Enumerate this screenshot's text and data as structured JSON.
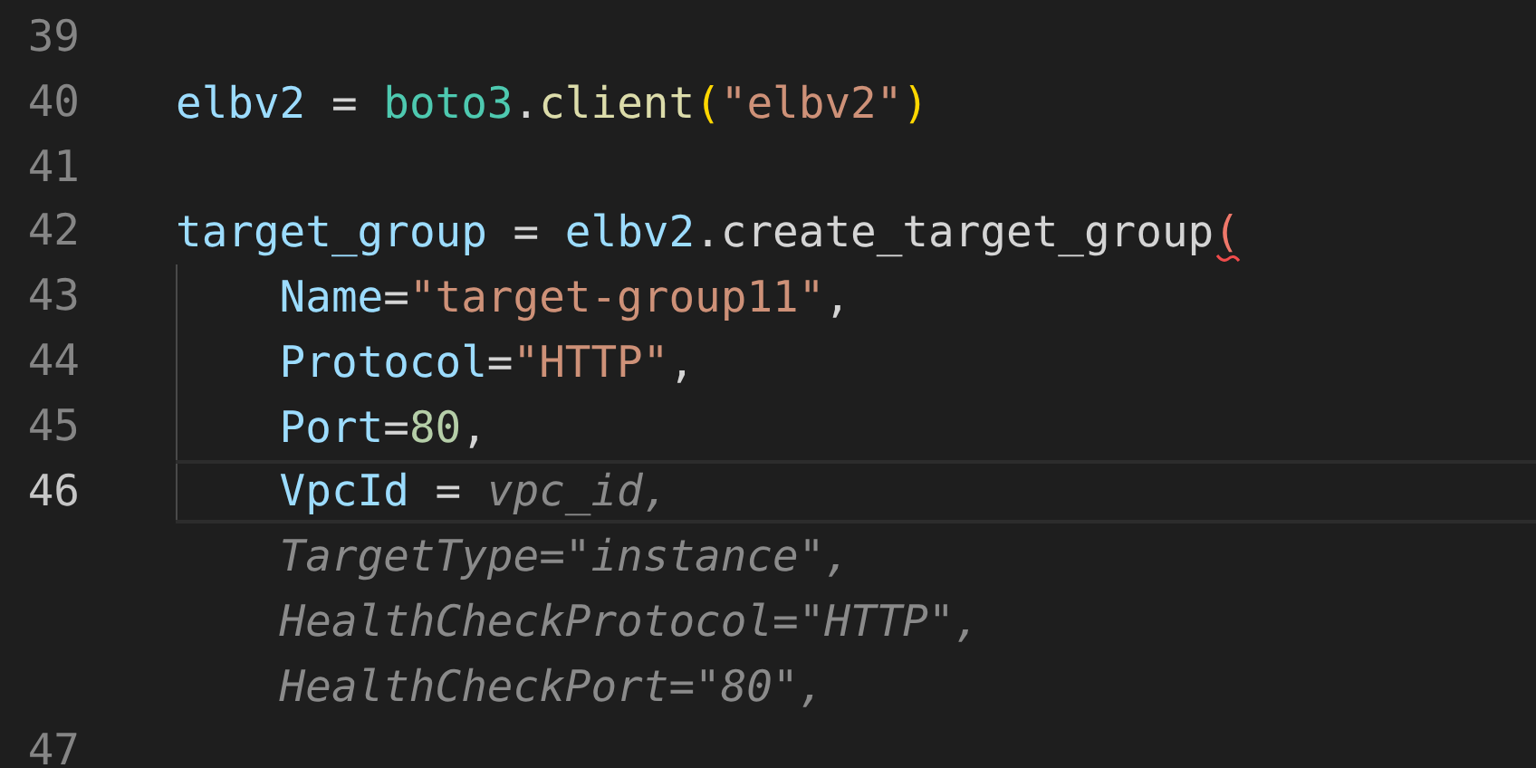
{
  "editor": {
    "lines": [
      {
        "kind": "code",
        "number": "39",
        "current": false
      },
      {
        "kind": "code",
        "number": "40",
        "current": false,
        "tokens": [
          {
            "kind": "variable",
            "text": "elbv2"
          },
          {
            "kind": "operator",
            "text": " = "
          },
          {
            "kind": "module",
            "text": "boto3"
          },
          {
            "kind": "plain",
            "text": "."
          },
          {
            "kind": "function",
            "text": "client"
          },
          {
            "kind": "bracket",
            "text": "("
          },
          {
            "kind": "string",
            "text": "\"elbv2\""
          },
          {
            "kind": "bracket",
            "text": ")"
          }
        ]
      },
      {
        "kind": "code",
        "number": "41",
        "current": false
      },
      {
        "kind": "code",
        "number": "42",
        "current": false,
        "tokens": [
          {
            "kind": "variable",
            "text": "target_group"
          },
          {
            "kind": "operator",
            "text": " = "
          },
          {
            "kind": "variable",
            "text": "elbv2"
          },
          {
            "kind": "plain",
            "text": ".create_target_group"
          },
          {
            "kind": "bracket_error",
            "text": "(",
            "error": true
          }
        ],
        "children": [
          {
            "kind": "code",
            "number": "43",
            "current": false,
            "guide": true,
            "tokens": [
              {
                "kind": "variable",
                "text": "Name"
              },
              {
                "kind": "operator",
                "text": "="
              },
              {
                "kind": "string",
                "text": "\"target-group11\""
              },
              {
                "kind": "plain",
                "text": ","
              }
            ]
          },
          {
            "kind": "code",
            "number": "44",
            "current": false,
            "guide": true,
            "tokens": [
              {
                "kind": "variable",
                "text": "Protocol"
              },
              {
                "kind": "operator",
                "text": "="
              },
              {
                "kind": "string",
                "text": "\"HTTP\""
              },
              {
                "kind": "plain",
                "text": ","
              }
            ]
          },
          {
            "kind": "code",
            "number": "45",
            "current": false,
            "guide": true,
            "tokens": [
              {
                "kind": "variable",
                "text": "Port"
              },
              {
                "kind": "operator",
                "text": "="
              },
              {
                "kind": "number",
                "text": "80"
              },
              {
                "kind": "plain",
                "text": ","
              }
            ]
          },
          {
            "kind": "code",
            "number": "46",
            "current": true,
            "guide": true,
            "tokens": [
              {
                "kind": "variable",
                "text": "VpcId"
              },
              {
                "kind": "operator",
                "text": " = "
              },
              {
                "kind": "ghost",
                "text": "vpc_id,"
              }
            ]
          },
          {
            "kind": "suggestion",
            "guide": false,
            "tokens": [
              {
                "kind": "ghost",
                "text": "TargetType=\"instance\","
              }
            ]
          },
          {
            "kind": "suggestion",
            "guide": false,
            "tokens": [
              {
                "kind": "ghost",
                "text": "HealthCheckProtocol=\"HTTP\","
              }
            ]
          },
          {
            "kind": "suggestion",
            "guide": false,
            "tokens": [
              {
                "kind": "ghost",
                "text": "HealthCheckPort=\"80\","
              }
            ]
          }
        ]
      },
      {
        "kind": "code",
        "number": "47",
        "current": false
      }
    ]
  }
}
